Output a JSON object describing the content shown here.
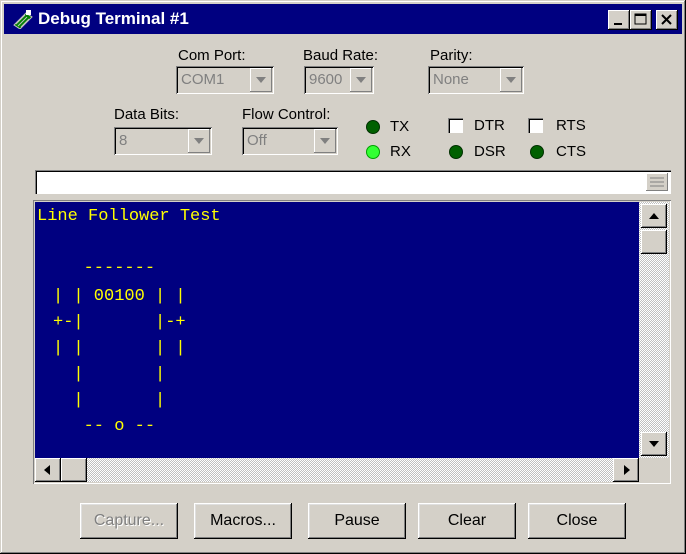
{
  "window": {
    "title": "Debug Terminal #1"
  },
  "settings": {
    "com_port": {
      "label": "Com Port:",
      "value": "COM1"
    },
    "baud_rate": {
      "label": "Baud Rate:",
      "value": "9600"
    },
    "parity": {
      "label": "Parity:",
      "value": "None"
    },
    "data_bits": {
      "label": "Data Bits:",
      "value": "8"
    },
    "flow_control": {
      "label": "Flow Control:",
      "value": "Off"
    }
  },
  "indicators": {
    "tx": {
      "label": "TX",
      "state": "off",
      "color": "#006000"
    },
    "rx": {
      "label": "RX",
      "state": "on",
      "color": "#33ff33"
    },
    "dtr": {
      "label": "DTR",
      "checked": false
    },
    "rts": {
      "label": "RTS",
      "checked": false
    },
    "dsr": {
      "label": "DSR",
      "state": "off",
      "color": "#006000"
    },
    "cts": {
      "label": "CTS",
      "state": "off",
      "color": "#006000"
    }
  },
  "transmit": {
    "value": ""
  },
  "terminal": {
    "background": "#000080",
    "text_color": "#ffff00",
    "lines": [
      "Line Follower Test",
      "",
      "   -------",
      "| | 00100 | |",
      "+-|       |-+",
      "| |       | |",
      "  |       |",
      "  |       |",
      "   -- o --"
    ]
  },
  "buttons": {
    "capture": "Capture...",
    "macros": "Macros...",
    "pause": "Pause",
    "clear": "Clear",
    "close": "Close"
  }
}
